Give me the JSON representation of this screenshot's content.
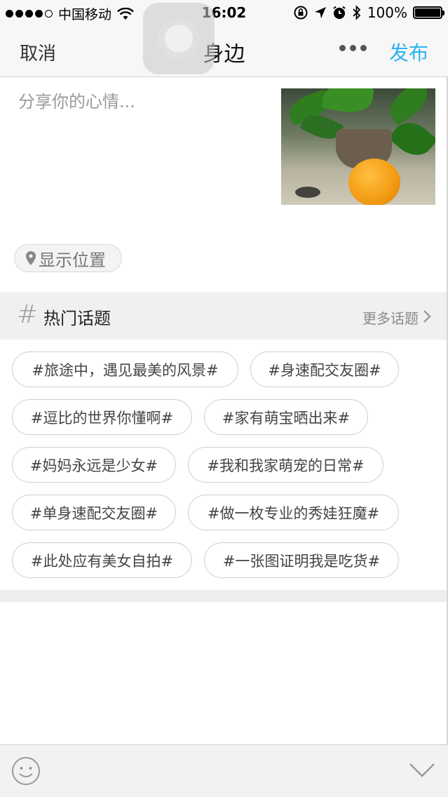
{
  "status_bar": {
    "carrier": "中国移动",
    "time": "16:02",
    "battery": "100%",
    "signal_bars": 4,
    "signal_max": 5
  },
  "nav": {
    "cancel": "取消",
    "title": "身边",
    "publish": "发布",
    "accent_color": "#2bb2f4"
  },
  "compose": {
    "placeholder": "分享你的心情...",
    "location_label": "显示位置"
  },
  "topics": {
    "hash": "#",
    "title": "热门话题",
    "more": "更多话题",
    "rows": [
      [
        "#旅途中，遇见最美的风景#",
        "#身速配交友圈#"
      ],
      [
        "#逗比的世界你懂啊#",
        "#家有萌宝晒出来#"
      ],
      [
        "#妈妈永远是少女#",
        "#我和我家萌宠的日常#"
      ],
      [
        "#单身速配交友圈#",
        "#做一枚专业的秀娃狂魔#"
      ],
      [
        "#此处应有美女自拍#",
        "#一张图证明我是吃货#"
      ]
    ]
  },
  "toolbar": {
    "emoji_icon": "smiley-icon",
    "collapse_icon": "chevron-down-icon"
  }
}
